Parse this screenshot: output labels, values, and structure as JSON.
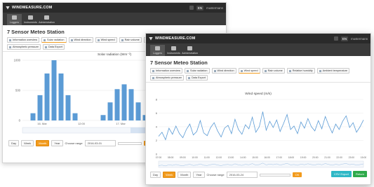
{
  "brand": "WINDMEASURE.COM",
  "lang": "EN",
  "user": "mustermann",
  "toolbar": [
    "Loggers",
    "Instruments",
    "Administration"
  ],
  "back_window": {
    "title": "7 Sensor Meteo Station",
    "tabs": [
      "Information overview",
      "Solar radiation",
      "Wind direction",
      "Wind speed",
      "Rain volume",
      "Relative humidity",
      "Ambient temperature",
      "Atmospheric pressure",
      "Data Export"
    ],
    "active_tab": "Solar radiation",
    "chart_title": "Solar radiation (Wm⁻²)",
    "y_ticks": [
      "1000",
      "500",
      "0"
    ],
    "x_ticks": [
      "16. Mar",
      "12:00",
      "17. Mar",
      "12:00",
      "18. Mar"
    ],
    "controls": {
      "day": "Day",
      "week": "Week",
      "month": "Month",
      "year": "Year",
      "range_label": "Choose range",
      "from_value": "2016-03-01",
      "to_value": "",
      "ok": "OK"
    }
  },
  "front_window": {
    "title": "7 Sensor Meteo Station",
    "tabs": [
      "Information overview",
      "Solar radiation",
      "Wind direction",
      "Wind speed",
      "Rain volume",
      "Relative humidity",
      "Ambient temperature",
      "Atmospheric pressure",
      "Data Export"
    ],
    "active_tab": "Wind speed",
    "chart_title": "Wind speed (m/s)",
    "y_ticks": [
      "8",
      "6",
      "4",
      "2",
      "0"
    ],
    "x_ticks": [
      "07:00",
      "08:00",
      "09:00",
      "10:00",
      "11:00",
      "12:00",
      "13:00",
      "14:00",
      "15:00",
      "16:00",
      "17:00",
      "18:00",
      "19:00",
      "20:00",
      "21:00",
      "22:00",
      "23:00",
      "15:00"
    ],
    "controls": {
      "day": "Day",
      "week": "Week",
      "month": "Month",
      "year": "Year",
      "range_label": "Choose range",
      "from_value": "2016-03-24",
      "to_value": "",
      "ok": "OK"
    },
    "csv_export": "CSV Export",
    "return": "Return"
  },
  "colors": {
    "accent": "#f29b1d",
    "topbar": "#2a2a2a",
    "toolbar": "#3a3a3a",
    "series": "#5b9bd5",
    "csv": "#2fb8c6",
    "return": "#2eaa4b"
  },
  "chart_data": [
    {
      "type": "bar",
      "title": "Solar radiation (Wm⁻²)",
      "ylabel": "",
      "xlabel": "",
      "categories": [
        "16. Mar",
        "12:00",
        "17. Mar",
        "12:00",
        "18. Mar"
      ],
      "ylim": [
        0,
        1000
      ],
      "series": [
        {
          "values": [
            0,
            120,
            420,
            780,
            1000,
            780,
            420,
            120,
            0,
            0,
            0,
            90,
            300,
            520,
            600,
            520,
            300,
            90,
            0,
            0,
            0,
            110,
            380,
            690,
            860,
            690,
            380,
            110
          ]
        }
      ]
    },
    {
      "type": "line",
      "title": "Wind speed (m/s)",
      "ylabel": "",
      "xlabel": "",
      "ylim": [
        0,
        8
      ],
      "categories": [
        "07:00",
        "08:00",
        "09:00",
        "10:00",
        "11:00",
        "12:00",
        "13:00",
        "14:00",
        "15:00",
        "16:00",
        "17:00",
        "18:00",
        "19:00",
        "20:00",
        "21:00",
        "22:00",
        "23:00",
        "15:00"
      ],
      "series": [
        {
          "values": [
            2.6,
            3.2,
            2.1,
            3.8,
            2.9,
            4.1,
            3.0,
            2.4,
            3.6,
            4.4,
            2.8,
            3.3,
            4.9,
            3.1,
            2.7,
            3.9,
            4.6,
            3.4,
            2.5,
            3.8,
            4.2,
            3.0,
            5.1,
            3.6,
            2.9,
            4.3,
            3.7,
            5.4,
            3.2,
            4.0,
            6.2,
            3.5,
            4.8,
            3.9,
            5.0,
            3.3,
            4.5,
            5.8,
            3.6,
            4.1,
            3.0,
            4.7,
            3.8,
            5.2,
            4.0,
            3.4,
            4.9,
            3.7,
            5.5,
            4.2,
            3.1,
            4.4,
            3.6,
            4.8,
            5.6,
            3.9,
            4.6,
            3.2,
            4.0,
            5.0
          ]
        }
      ]
    }
  ]
}
